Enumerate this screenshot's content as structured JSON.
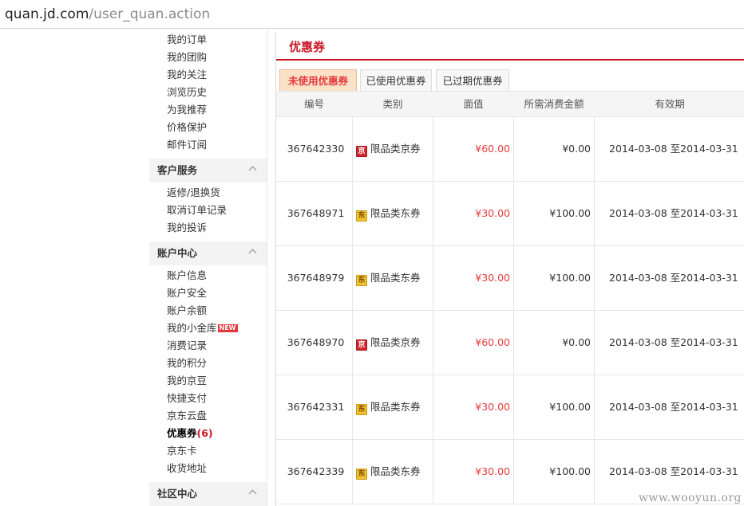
{
  "address_bar": {
    "host": "quan.jd.com",
    "path": "/user_quan.action"
  },
  "sidebar": {
    "top_links": [
      "我的订单",
      "我的团购",
      "我的关注",
      "浏览历史",
      "为我推荐",
      "价格保护",
      "邮件订阅"
    ],
    "sections": [
      {
        "title": "客户服务",
        "links": [
          "返修/退换货",
          "取消订单记录",
          "我的投诉"
        ]
      },
      {
        "title": "账户中心",
        "links": [
          "账户信息",
          "账户安全",
          "账户余额",
          "我的小金库",
          "消费记录",
          "我的积分",
          "我的京豆",
          "快捷支付",
          "京东云盘",
          "优惠券",
          "京东卡",
          "收货地址"
        ],
        "new_badge": "NEW",
        "active_count": "(6)"
      },
      {
        "title": "社区中心",
        "links": []
      }
    ]
  },
  "main": {
    "title": "优惠券",
    "tabs": [
      "未使用优惠券",
      "已使用优惠券",
      "已过期优惠券"
    ],
    "active_tab": "未使用优惠券",
    "columns": [
      "编号",
      "类别",
      "面值",
      "所需消费金额",
      "有效期"
    ],
    "rows": [
      {
        "id": "367642330",
        "icon": "京",
        "icon_name": "jing-coupon-icon",
        "type": "限品类京券",
        "value": "¥60.00",
        "min_spend": "¥0.00",
        "valid": "2014-03-08 至2014-03-31"
      },
      {
        "id": "367648971",
        "icon": "东",
        "icon_name": "dong-coupon-icon",
        "type": "限品类东券",
        "value": "¥30.00",
        "min_spend": "¥100.00",
        "valid": "2014-03-08 至2014-03-31"
      },
      {
        "id": "367648979",
        "icon": "东",
        "icon_name": "dong-coupon-icon",
        "type": "限品类东券",
        "value": "¥30.00",
        "min_spend": "¥100.00",
        "valid": "2014-03-08 至2014-03-31"
      },
      {
        "id": "367648970",
        "icon": "京",
        "icon_name": "jing-coupon-icon",
        "type": "限品类京券",
        "value": "¥60.00",
        "min_spend": "¥0.00",
        "valid": "2014-03-08 至2014-03-31"
      },
      {
        "id": "367642331",
        "icon": "东",
        "icon_name": "dong-coupon-icon",
        "type": "限品类东券",
        "value": "¥30.00",
        "min_spend": "¥100.00",
        "valid": "2014-03-08 至2014-03-31"
      },
      {
        "id": "367642339",
        "icon": "东",
        "icon_name": "dong-coupon-icon",
        "type": "限品类东券",
        "value": "¥30.00",
        "min_spend": "¥100.00",
        "valid": "2014-03-08 至2014-03-31"
      }
    ]
  },
  "watermark": "www.wooyun.org",
  "colors": {
    "accent_red": "#c91623",
    "price_red": "#e4393c",
    "active_tab_bg": "#fbe1c8"
  }
}
